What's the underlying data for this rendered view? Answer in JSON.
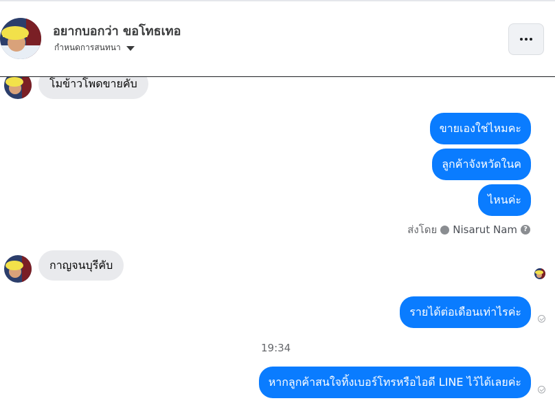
{
  "header": {
    "contact_name": "อยากบอกว่า ขอโทธเทอ",
    "conversation_settings": "กำหนดการสนทนา",
    "avatar_icon": "profile-photo-yellow-hat",
    "more_icon": "more-dots-icon"
  },
  "messages": [
    {
      "side": "incoming",
      "text": "โมข้าวโพดขายคับ"
    },
    {
      "side": "outgoing",
      "text": "ขายเองใช่ไหมคะ"
    },
    {
      "side": "outgoing",
      "text": "ลูกค้าจังหวัดในค"
    },
    {
      "side": "outgoing",
      "text": "ไหนค่ะ"
    },
    {
      "side": "incoming",
      "text": "กาญจนบุรีคับ"
    },
    {
      "side": "outgoing",
      "text": "รายได้ต่อเดือนเท่าไรค่ะ"
    },
    {
      "side": "outgoing",
      "text": "หากลูกค้าสนใจทิ้งเบอร์โทรหรือไอดี LINE ไว้ได้เลยค่ะ"
    }
  ],
  "sent_by": {
    "prefix": "ส่งโดย",
    "name": "Nisarut Nam",
    "help_glyph": "?"
  },
  "timestamp": "19:34",
  "colors": {
    "outgoing_bubble": "#0a7cff",
    "incoming_bubble": "#e9eaed",
    "header_divider": "#1c1e21"
  }
}
